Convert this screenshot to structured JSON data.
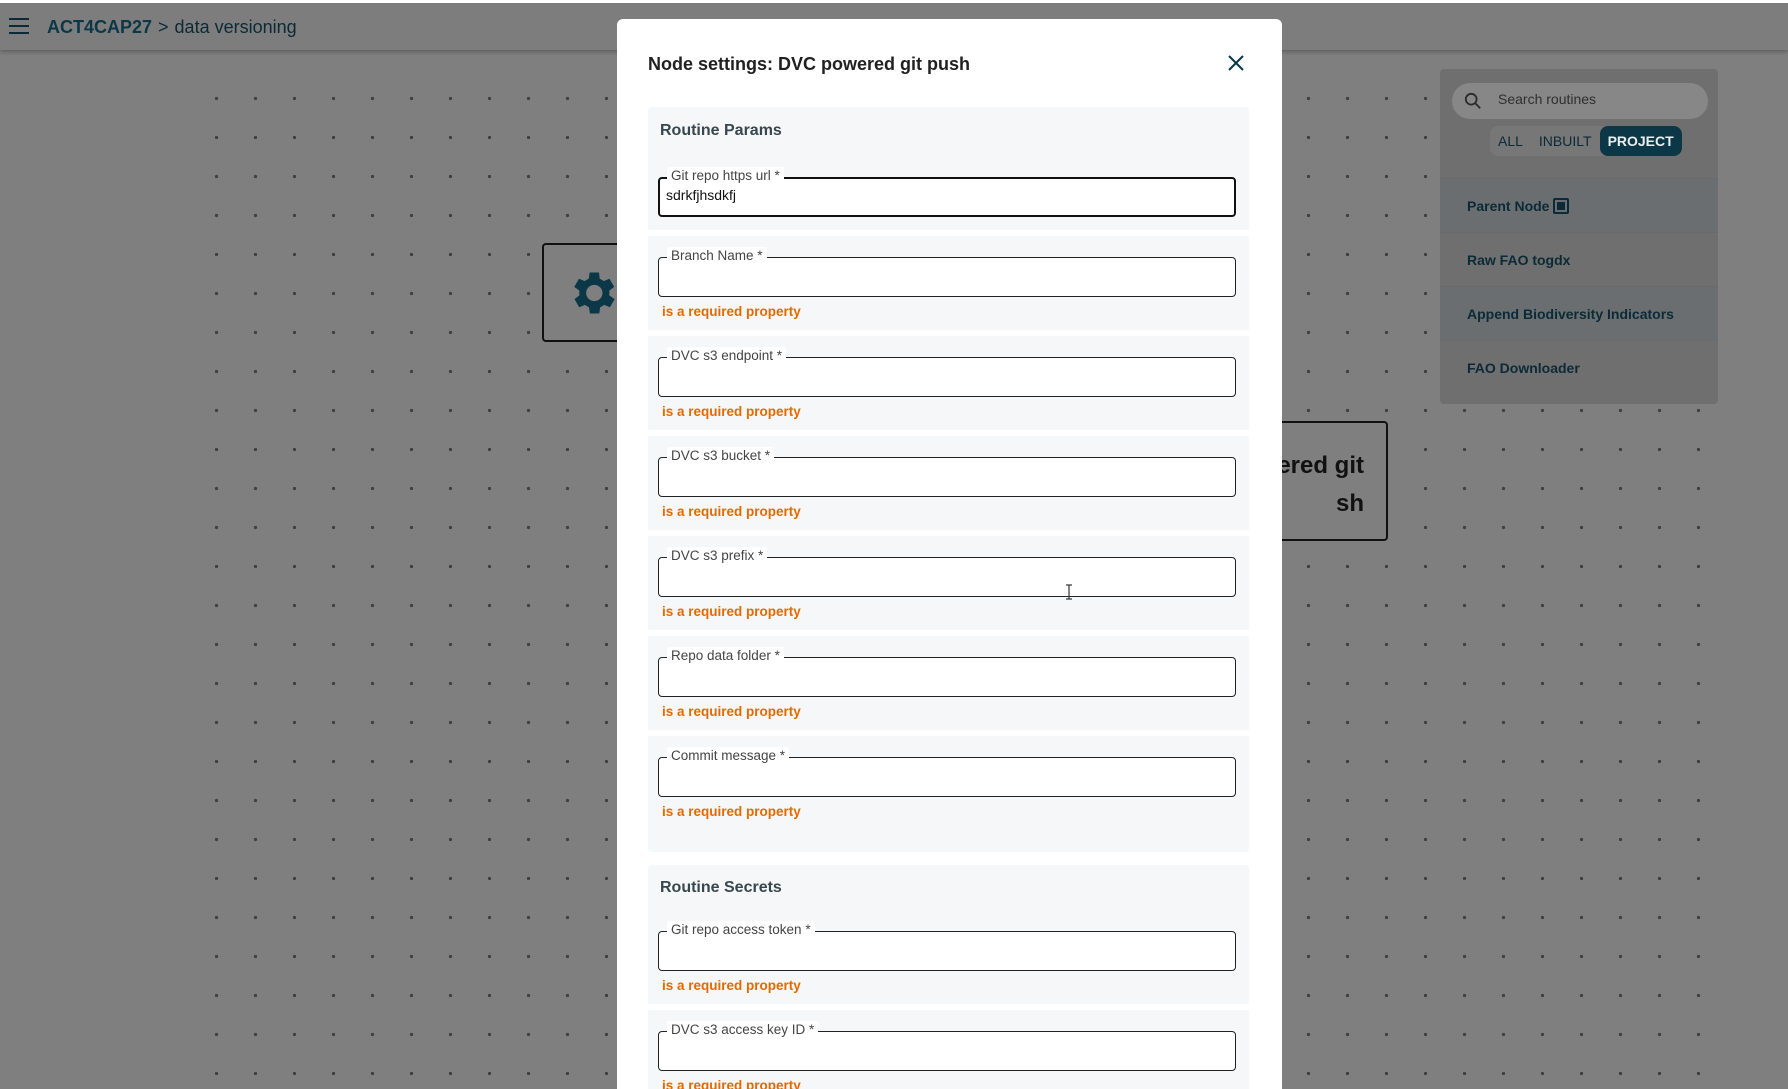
{
  "header": {
    "menu_icon": "hamburger-menu-icon",
    "project": "ACT4CAP27",
    "separator": ">",
    "page": "data versioning"
  },
  "canvas": {
    "node_right_text_line1": "ered git",
    "node_right_text_line2": "sh",
    "node_left_icon": "gear-icon"
  },
  "routines_panel": {
    "search_placeholder": "Search routines",
    "filters": [
      "ALL",
      "INBUILT",
      "PROJECT"
    ],
    "active_filter": "PROJECT",
    "items": [
      {
        "label": "Parent Node",
        "icon": "chip-icon"
      },
      {
        "label": "Raw FAO togdx"
      },
      {
        "label": "Append Biodiversity Indicators"
      },
      {
        "label": "FAO Downloader"
      }
    ]
  },
  "modal": {
    "title": "Node settings: DVC powered git push",
    "params_title": "Routine Params",
    "secrets_title": "Routine Secrets",
    "required_msg": "is a required property",
    "fields": {
      "git_url": {
        "label": "Git repo https url *",
        "value": "sdrkfjhsdkfj"
      },
      "branch": {
        "label": "Branch Name *",
        "value": ""
      },
      "s3_endpoint": {
        "label": "DVC s3 endpoint *",
        "value": ""
      },
      "s3_bucket": {
        "label": "DVC s3 bucket *",
        "value": ""
      },
      "s3_prefix": {
        "label": "DVC s3 prefix *",
        "value": ""
      },
      "data_folder": {
        "label": "Repo data folder *",
        "value": ""
      },
      "commit_msg": {
        "label": "Commit message *",
        "value": ""
      },
      "access_token": {
        "label": "Git repo access token *",
        "value": ""
      },
      "access_key": {
        "label": "DVC s3 access key ID *",
        "value": ""
      }
    }
  },
  "colors": {
    "brand_dark": "#0b3746",
    "error": "#e26a00",
    "overlay": "#7f7f7f"
  }
}
